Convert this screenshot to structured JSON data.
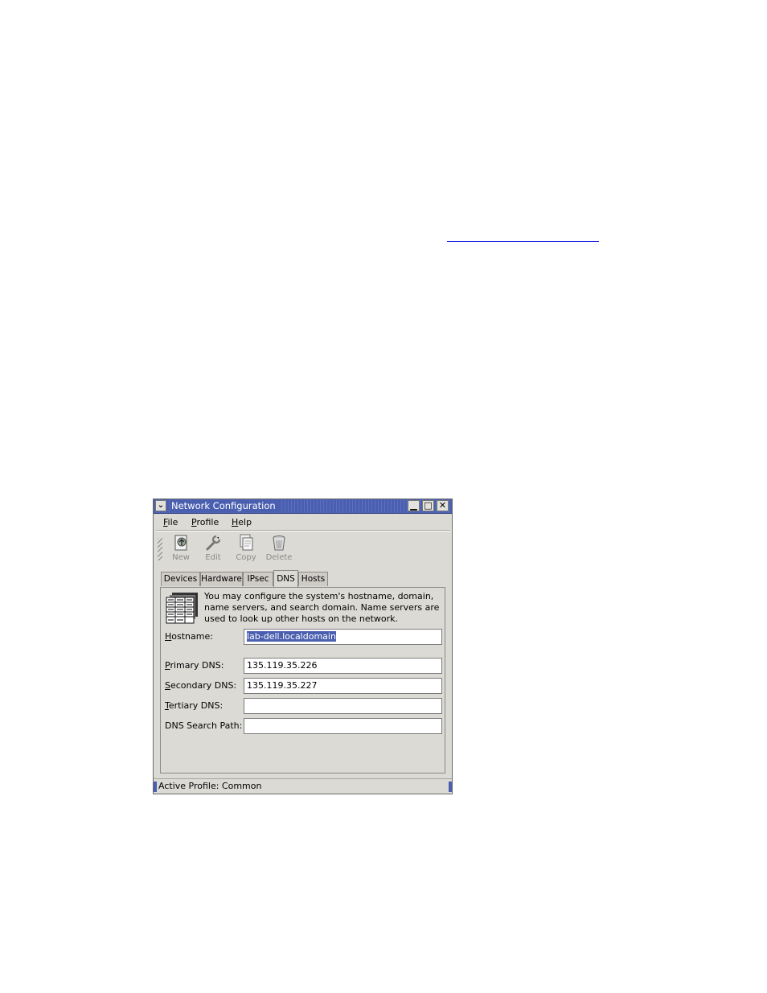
{
  "window": {
    "title": "Network Configuration",
    "menu_button_glyph": "⌄",
    "minimize_glyph": "▁",
    "maximize_glyph": "□",
    "close_glyph": "✕"
  },
  "menubar": {
    "items": [
      {
        "label": "File",
        "mnemonic": "F"
      },
      {
        "label": "Profile",
        "mnemonic": "P"
      },
      {
        "label": "Help",
        "mnemonic": "H"
      }
    ]
  },
  "toolbar": {
    "buttons": [
      {
        "label": "New",
        "icon": "new-icon",
        "enabled": false
      },
      {
        "label": "Edit",
        "icon": "wrench-icon",
        "enabled": false
      },
      {
        "label": "Copy",
        "icon": "copy-icon",
        "enabled": false
      },
      {
        "label": "Delete",
        "icon": "trash-icon",
        "enabled": false
      }
    ]
  },
  "tabs": [
    {
      "label": "Devices",
      "active": false
    },
    {
      "label": "Hardware",
      "active": false
    },
    {
      "label": "IPsec",
      "active": false
    },
    {
      "label": "DNS",
      "active": true
    },
    {
      "label": "Hosts",
      "active": false
    }
  ],
  "dns": {
    "description": "You may configure the system's hostname, domain, name servers, and search domain. Name servers are used to look up other hosts on the network.",
    "icon": "dns-table-icon",
    "hostname": {
      "label": "Hostname:",
      "value": "lab-dell.localdomain"
    },
    "primary_dns": {
      "label": "Primary DNS:",
      "value": "135.119.35.226"
    },
    "secondary_dns": {
      "label": "Secondary DNS:",
      "value": "135.119.35.227"
    },
    "tertiary_dns": {
      "label": "Tertiary DNS:",
      "value": ""
    },
    "search_path": {
      "label": "DNS Search Path:",
      "value": ""
    }
  },
  "status": {
    "text": "Active Profile: Common"
  },
  "colors": {
    "titlebar": "#4a5fb0",
    "window_bg": "#dcdad5",
    "disabled_text": "#8d8b86",
    "selection": "#4a5fb0"
  }
}
